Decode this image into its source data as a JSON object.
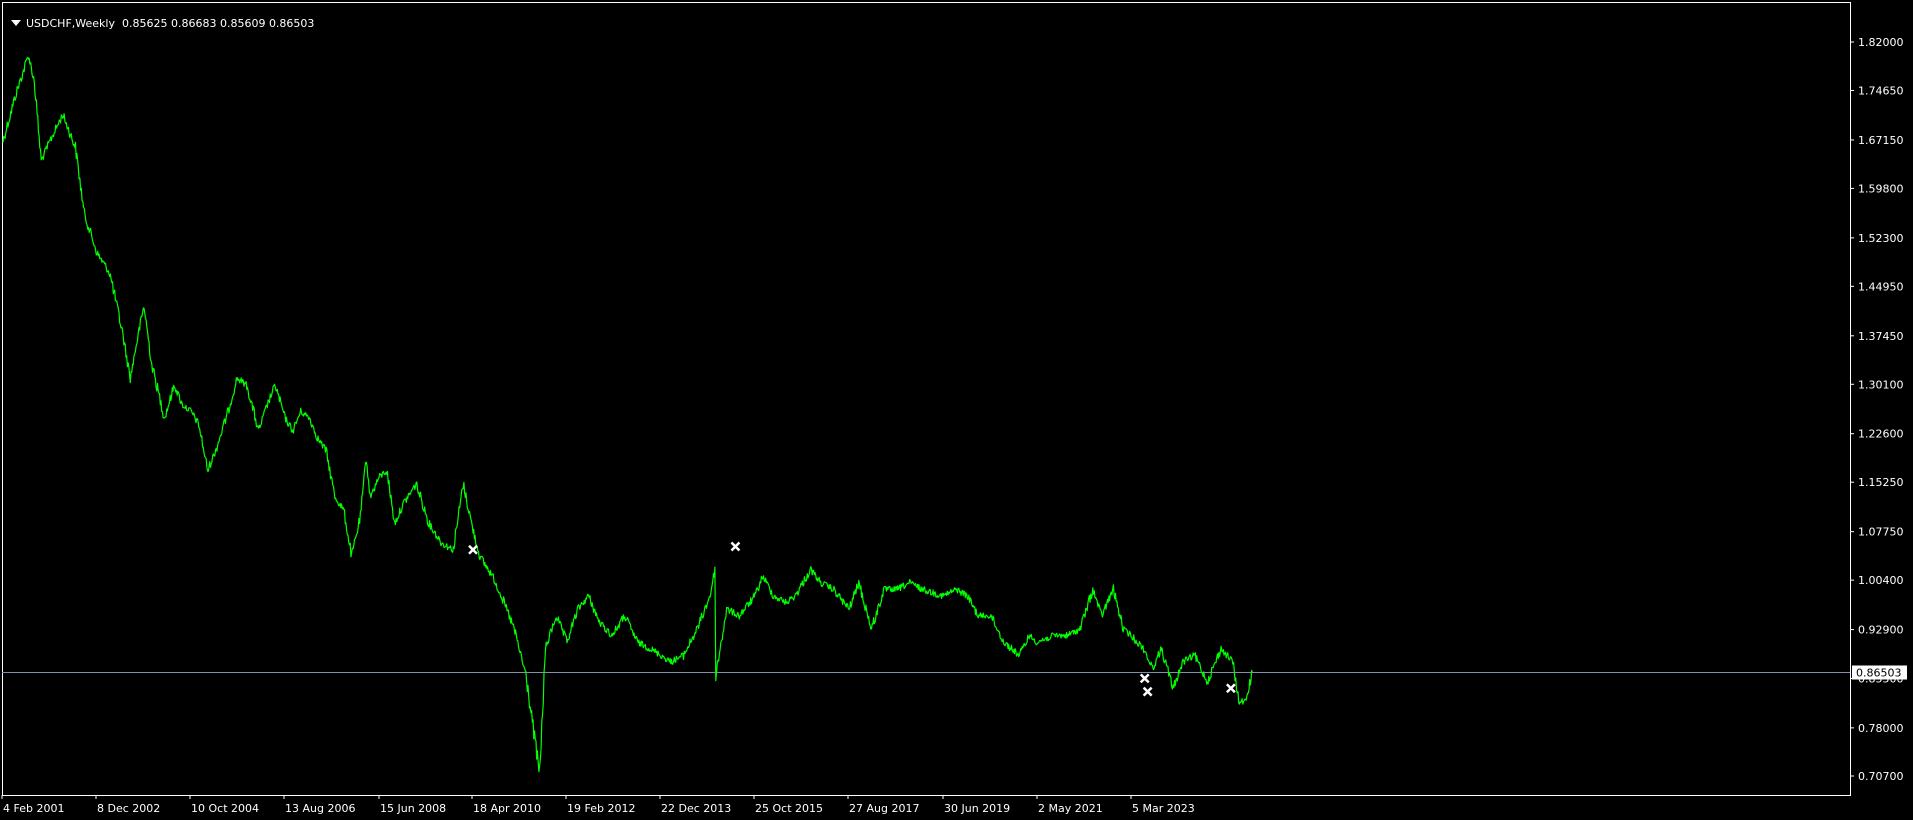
{
  "header": {
    "symbol": "USDCHF,Weekly",
    "ohlc": "0.85625 0.86683 0.85609 0.86503"
  },
  "colors": {
    "background": "#000000",
    "price_line": "#00ff00",
    "frame": "#ffffff",
    "current_price_line": "#8090a8",
    "marker": "#ffffff"
  },
  "chart_data": {
    "type": "line",
    "title": "USDCHF,Weekly",
    "xlabel": "",
    "ylabel": "",
    "grid": false,
    "x_tick_labels": [
      "4 Feb 2001",
      "8 Dec 2002",
      "10 Oct 2004",
      "13 Aug 2006",
      "15 Jun 2008",
      "18 Apr 2010",
      "19 Feb 2012",
      "22 Dec 2013",
      "25 Oct 2015",
      "27 Aug 2017",
      "30 Jun 2019",
      "2 May 2021",
      "5 Mar 2023"
    ],
    "y_ticks": [
      {
        "value": 1.82,
        "label": "1.82000"
      },
      {
        "value": 1.7465,
        "label": "1.74650"
      },
      {
        "value": 1.6715,
        "label": "1.67150"
      },
      {
        "value": 1.598,
        "label": "1.59800"
      },
      {
        "value": 1.523,
        "label": "1.52300"
      },
      {
        "value": 1.4495,
        "label": "1.44950"
      },
      {
        "value": 1.3745,
        "label": "1.37450"
      },
      {
        "value": 1.301,
        "label": "1.30100"
      },
      {
        "value": 1.226,
        "label": "1.22600"
      },
      {
        "value": 1.1525,
        "label": "1.15250"
      },
      {
        "value": 1.0775,
        "label": "1.07750"
      },
      {
        "value": 1.004,
        "label": "1.00400"
      },
      {
        "value": 0.929,
        "label": "0.92900"
      },
      {
        "value": 0.855,
        "label": "0.85500"
      },
      {
        "value": 0.78,
        "label": "0.78000"
      },
      {
        "value": 0.707,
        "label": "0.70700"
      }
    ],
    "current_price": {
      "value": 0.86503,
      "label": "0.86503"
    },
    "series": [
      {
        "points": [
          [
            "2001-02-04",
            1.67
          ],
          [
            "2001-05-06",
            1.74
          ],
          [
            "2001-08-05",
            1.8
          ],
          [
            "2001-09-16",
            1.76
          ],
          [
            "2001-11-04",
            1.64
          ],
          [
            "2002-01-06",
            1.67
          ],
          [
            "2002-04-07",
            1.71
          ],
          [
            "2002-07-07",
            1.66
          ],
          [
            "2002-09-08",
            1.56
          ],
          [
            "2002-12-08",
            1.5
          ],
          [
            "2003-03-09",
            1.47
          ],
          [
            "2003-06-08",
            1.38
          ],
          [
            "2003-08-03",
            1.31
          ],
          [
            "2003-09-14",
            1.36
          ],
          [
            "2003-11-09",
            1.42
          ],
          [
            "2004-01-04",
            1.33
          ],
          [
            "2004-04-04",
            1.25
          ],
          [
            "2004-06-13",
            1.3
          ],
          [
            "2004-08-08",
            1.27
          ],
          [
            "2004-10-10",
            1.26
          ],
          [
            "2004-12-05",
            1.24
          ],
          [
            "2005-02-06",
            1.17
          ],
          [
            "2005-04-03",
            1.2
          ],
          [
            "2005-07-03",
            1.26
          ],
          [
            "2005-09-04",
            1.31
          ],
          [
            "2005-11-13",
            1.3
          ],
          [
            "2006-02-05",
            1.23
          ],
          [
            "2006-04-09",
            1.27
          ],
          [
            "2006-06-04",
            1.3
          ],
          [
            "2006-08-13",
            1.25
          ],
          [
            "2006-10-08",
            1.23
          ],
          [
            "2006-12-03",
            1.26
          ],
          [
            "2007-02-04",
            1.25
          ],
          [
            "2007-04-01",
            1.22
          ],
          [
            "2007-06-03",
            1.2
          ],
          [
            "2007-08-05",
            1.13
          ],
          [
            "2007-10-07",
            1.11
          ],
          [
            "2007-12-02",
            1.04
          ],
          [
            "2008-02-03",
            1.1
          ],
          [
            "2008-03-16",
            1.19
          ],
          [
            "2008-04-13",
            1.13
          ],
          [
            "2008-06-15",
            1.16
          ],
          [
            "2008-08-10",
            1.17
          ],
          [
            "2008-10-05",
            1.09
          ],
          [
            "2008-12-07",
            1.12
          ],
          [
            "2009-03-08",
            1.15
          ],
          [
            "2009-06-07",
            1.09
          ],
          [
            "2009-09-06",
            1.06
          ],
          [
            "2009-11-29",
            1.05
          ],
          [
            "2010-02-07",
            1.15
          ],
          [
            "2010-04-18",
            1.08
          ],
          [
            "2010-06-06",
            1.04
          ],
          [
            "2010-09-05",
            1.01
          ],
          [
            "2010-11-07",
            0.98
          ],
          [
            "2011-02-06",
            0.93
          ],
          [
            "2011-05-01",
            0.86
          ],
          [
            "2011-08-07",
            0.71
          ],
          [
            "2011-09-18",
            0.9
          ],
          [
            "2011-12-04",
            0.95
          ],
          [
            "2012-02-19",
            0.91
          ],
          [
            "2012-05-06",
            0.96
          ],
          [
            "2012-07-22",
            0.98
          ],
          [
            "2012-10-07",
            0.94
          ],
          [
            "2013-01-06",
            0.92
          ],
          [
            "2013-04-07",
            0.95
          ],
          [
            "2013-07-07",
            0.91
          ],
          [
            "2013-10-06",
            0.9
          ],
          [
            "2013-12-22",
            0.89
          ],
          [
            "2014-03-02",
            0.88
          ],
          [
            "2014-06-01",
            0.89
          ],
          [
            "2014-09-07",
            0.93
          ],
          [
            "2014-12-07",
            0.98
          ],
          [
            "2015-01-11",
            1.02
          ],
          [
            "2015-01-18",
            0.86
          ],
          [
            "2015-04-05",
            0.96
          ],
          [
            "2015-07-05",
            0.95
          ],
          [
            "2015-10-25",
            0.98
          ],
          [
            "2015-12-20",
            1.01
          ],
          [
            "2016-03-06",
            0.98
          ],
          [
            "2016-06-05",
            0.97
          ],
          [
            "2016-08-07",
            0.98
          ],
          [
            "2016-11-27",
            1.02
          ],
          [
            "2017-02-05",
            1.0
          ],
          [
            "2017-05-07",
            0.99
          ],
          [
            "2017-08-27",
            0.96
          ],
          [
            "2017-11-05",
            1.0
          ],
          [
            "2018-02-04",
            0.93
          ],
          [
            "2018-05-06",
            0.99
          ],
          [
            "2018-08-05",
            0.99
          ],
          [
            "2018-11-04",
            1.0
          ],
          [
            "2019-02-03",
            0.99
          ],
          [
            "2019-06-30",
            0.98
          ],
          [
            "2019-10-06",
            0.99
          ],
          [
            "2019-12-22",
            0.98
          ],
          [
            "2020-03-08",
            0.95
          ],
          [
            "2020-06-07",
            0.95
          ],
          [
            "2020-09-06",
            0.91
          ],
          [
            "2020-12-27",
            0.89
          ],
          [
            "2021-03-07",
            0.92
          ],
          [
            "2021-05-02",
            0.91
          ],
          [
            "2021-09-05",
            0.92
          ],
          [
            "2021-12-05",
            0.92
          ],
          [
            "2022-03-06",
            0.93
          ],
          [
            "2022-06-05",
            0.99
          ],
          [
            "2022-08-07",
            0.95
          ],
          [
            "2022-10-30",
            0.99
          ],
          [
            "2023-01-08",
            0.93
          ],
          [
            "2023-03-05",
            0.92
          ],
          [
            "2023-06-04",
            0.9
          ],
          [
            "2023-08-06",
            0.87
          ],
          [
            "2023-10-08",
            0.9
          ],
          [
            "2023-12-31",
            0.84
          ],
          [
            "2024-03-10",
            0.88
          ],
          [
            "2024-06-02",
            0.89
          ],
          [
            "2024-09-01",
            0.85
          ],
          [
            "2024-12-08",
            0.9
          ],
          [
            "2025-03-02",
            0.88
          ],
          [
            "2025-04-13",
            0.82
          ],
          [
            "2025-06-01",
            0.82
          ],
          [
            "2025-07-20",
            0.865
          ]
        ]
      }
    ],
    "markers": [
      {
        "x": "2010-04-18",
        "y": 1.05
      },
      {
        "x": "2015-06-07",
        "y": 1.055
      },
      {
        "x": "2023-06-11",
        "y": 0.855
      },
      {
        "x": "2023-07-02",
        "y": 0.835
      },
      {
        "x": "2025-02-16",
        "y": 0.84
      }
    ]
  }
}
